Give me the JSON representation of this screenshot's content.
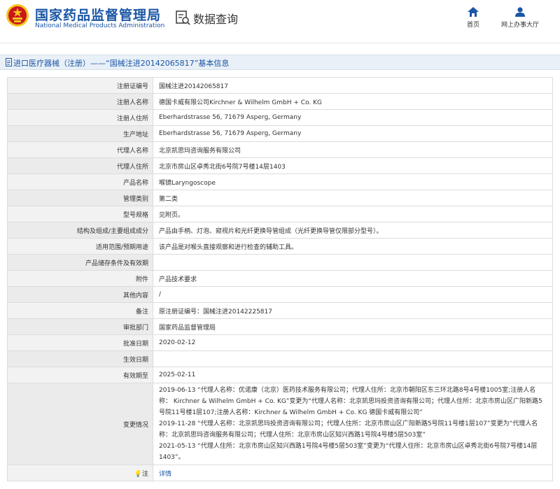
{
  "header": {
    "site_name_cn": "国家药品监督管理局",
    "site_name_en": "National Medical Products Administration",
    "query_title": "数据查询",
    "nav": [
      {
        "label": "首页",
        "icon": "home-icon"
      },
      {
        "label": "网上办事大厅",
        "icon": "person-icon"
      }
    ],
    "colors": {
      "brand": "#1a56a5",
      "emblem_red": "#c8161d",
      "emblem_gold": "#f5c518"
    }
  },
  "breadcrumb": {
    "text": "进口医疗器械（注册）——“国械注进20142065817”基本信息"
  },
  "detail": {
    "rows": [
      {
        "label": "注册证编号",
        "value": "国械注进20142065817"
      },
      {
        "label": "注册人名称",
        "value": "德国卡威有限公司Kirchner & Wilhelm GmbH + Co. KG"
      },
      {
        "label": "注册人住所",
        "value": "Eberhardstrasse 56, 71679 Asperg, Germany"
      },
      {
        "label": "生产地址",
        "value": "Eberhardstrasse 56, 71679 Asperg, Germany"
      },
      {
        "label": "代理人名称",
        "value": "北京凯思玛咨询服务有限公司"
      },
      {
        "label": "代理人住所",
        "value": "北京市房山区卓秀北街6号院7号楼14层1403"
      },
      {
        "label": "产品名称",
        "value": "喉镜Laryngoscope"
      },
      {
        "label": "管理类别",
        "value": "第二类"
      },
      {
        "label": "型号规格",
        "value": "见附页。"
      },
      {
        "label": "结构及组成/主要组成成分",
        "value": "产品由手柄、灯泡、窥视片和光纤更换导管组成（光纤更换导管仅限部分型号）。"
      },
      {
        "label": "适用范围/预期用途",
        "value": "该产品是对喉头直接观察和进行检查的辅助工具。"
      },
      {
        "label": "产品储存条件及有效期",
        "value": ""
      },
      {
        "label": "附件",
        "value": "产品技术要求"
      },
      {
        "label": "其他内容",
        "value": "/"
      },
      {
        "label": "备注",
        "value": "原注册证编号：国械注进20142225817"
      },
      {
        "label": "审批部门",
        "value": "国家药品监督管理局"
      },
      {
        "label": "批准日期",
        "value": "2020-02-12"
      },
      {
        "label": "生效日期",
        "value": ""
      },
      {
        "label": "有效期至",
        "value": "2025-02-11"
      }
    ],
    "changes_label": "变更情况",
    "changes": [
      "2019-06-13 “代理人名称：优诺康（北京）医药技术服务有限公司；代理人住所：北京市朝阳区东三环北路8号4号楼1005室;注册人名称： Kirchner & Wilhelm GmbH + Co. KG”变更为“代理人名称：北京凯思玛投资咨询有限公司；代理人住所：北京市房山区广阳新路5号院11号楼1层107;注册人名称：Kirchner & Wilhelm GmbH + Co. KG 德国卡威有限公司”",
      "2019-11-28 “代理人名称：北京凯思玛投资咨询有限公司；代理人住所：北京市房山区广阳新路5号院11号楼1层107”变更为“代理人名称：北京凯思玛咨询服务有限公司；代理人住所：北京市房山区知兴西路1号院4号楼5层503室”",
      "2021-05-13 “代理人住所：北京市房山区知兴西路1号院4号楼5层503室”变更为“代理人住所：北京市房山区卓秀北街6号院7号楼14层1403”。"
    ],
    "note_label": "注",
    "note_link": "详情"
  }
}
